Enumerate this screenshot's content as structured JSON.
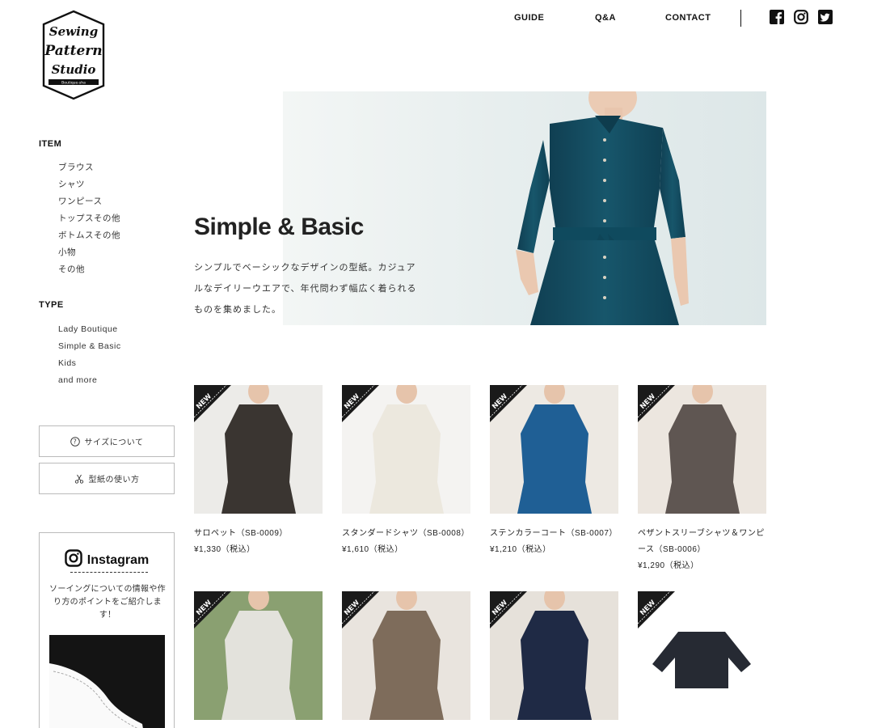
{
  "brand": {
    "logo_line1": "Sewing",
    "logo_line2": "Pattern",
    "logo_line3": "Studio",
    "logo_sub": "Boutique-sha"
  },
  "nav": {
    "items": [
      {
        "label": "GUIDE"
      },
      {
        "label": "Q&A"
      },
      {
        "label": "CONTACT"
      }
    ],
    "social": [
      "facebook-icon",
      "instagram-icon",
      "twitter-icon"
    ]
  },
  "sidebar": {
    "item_title": "ITEM",
    "items": [
      "ブラウス",
      "シャツ",
      "ワンピース",
      "トップスその他",
      "ボトムスその他",
      "小物",
      "その他"
    ],
    "type_title": "TYPE",
    "types": [
      "Lady Boutique",
      "Simple & Basic",
      "Kids",
      "and more"
    ],
    "size_button": "サイズについて",
    "pattern_button": "型紙の使い方",
    "instagram": {
      "title": "Instagram",
      "text": "ソーイングについての情報や作り方のポイントをご紹介します！"
    }
  },
  "hero": {
    "title": "Simple & Basic",
    "description": "シンプルでベーシックなデザインの型紙。カジュアルなデイリーウエアで、年代問わず幅広く着られるものを集めました。"
  },
  "badge_label": "NEW",
  "products": [
    {
      "name": "サロペット（SB-0009）",
      "price": "¥1,330（税込）",
      "color": "#3a3531",
      "bg": "#ecebe8"
    },
    {
      "name": "スタンダードシャツ（SB-0008）",
      "price": "¥1,610（税込）",
      "color": "#ece8de",
      "bg": "#f4f3f1"
    },
    {
      "name": "ステンカラーコート（SB-0007）",
      "price": "¥1,210（税込）",
      "color": "#1f5f95",
      "bg": "#ede9e3"
    },
    {
      "name": "ペザントスリーブシャツ＆ワンピース（SB-0006）",
      "price": "¥1,290（税込）",
      "color": "#5f5652",
      "bg": "#ece6df"
    },
    {
      "name": "",
      "price": "",
      "color": "#e3e2dc",
      "bg": "#8aa071"
    },
    {
      "name": "",
      "price": "",
      "color": "#7e6c5b",
      "bg": "#e9e4de"
    },
    {
      "name": "",
      "price": "",
      "color": "#1f2a45",
      "bg": "#e6e1da"
    },
    {
      "name": "",
      "price": "",
      "color": "#262a33",
      "bg": "#ffffff"
    }
  ],
  "colors": {
    "text": "#222222",
    "hero_dress": "#17566b",
    "border": "#bbbbbb"
  }
}
